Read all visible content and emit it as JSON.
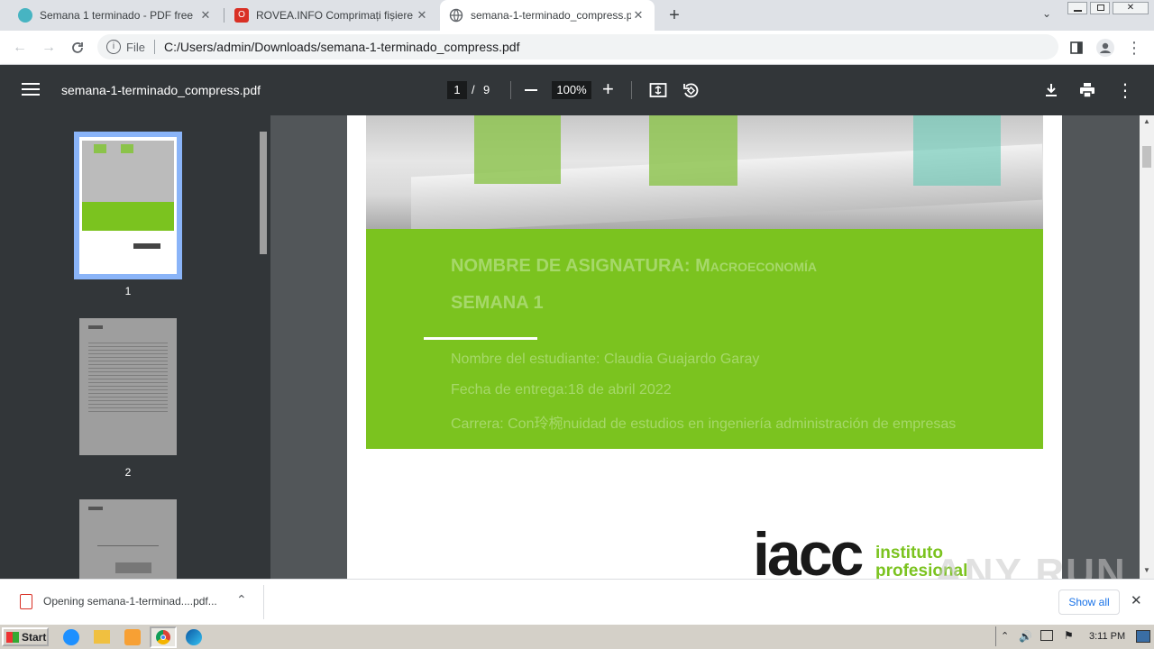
{
  "browser": {
    "tabs": [
      {
        "title": "Semana 1 terminado - PDF free",
        "icon": "globe-teal-icon"
      },
      {
        "title": "ROVEA.INFO Comprimați fișiere PDF",
        "icon": "red-o-icon"
      },
      {
        "title": "semana-1-terminado_compress.pdf",
        "icon": "globe-icon",
        "active": true
      }
    ],
    "omnibox": {
      "scheme_label": "File",
      "url": "C:/Users/admin/Downloads/semana-1-terminado_compress.pdf"
    }
  },
  "pdf_viewer": {
    "file_name": "semana-1-terminado_compress.pdf",
    "current_page": "1",
    "page_separator": "/",
    "total_pages": "9",
    "zoom": "100%",
    "thumbnails": [
      {
        "label": "1"
      },
      {
        "label": "2"
      }
    ]
  },
  "document": {
    "course": "NOMBRE DE ASIGNATURA: Macroeconomía",
    "week": "SEMANA 1",
    "student": "Nombre del estudiante: Claudia Guajardo Garay",
    "date": "Fecha de entrega:18 de abril 2022",
    "career": "Carrera: Con玲椀nuidad de estudios en ingeniería administración de empresas",
    "logo_text": "iacc",
    "logo_sub1": "instituto",
    "logo_sub2": "profesional"
  },
  "watermark": "ANY RUN",
  "download_bar": {
    "item_label": "Opening semana-1-terminad....pdf...",
    "show_all": "Show all"
  },
  "taskbar": {
    "start_label": "Start",
    "clock": "3:11 PM"
  },
  "colors": {
    "green": "#7bc31f",
    "pdf_toolbar": "#323639",
    "viewer_bg": "#525659"
  }
}
